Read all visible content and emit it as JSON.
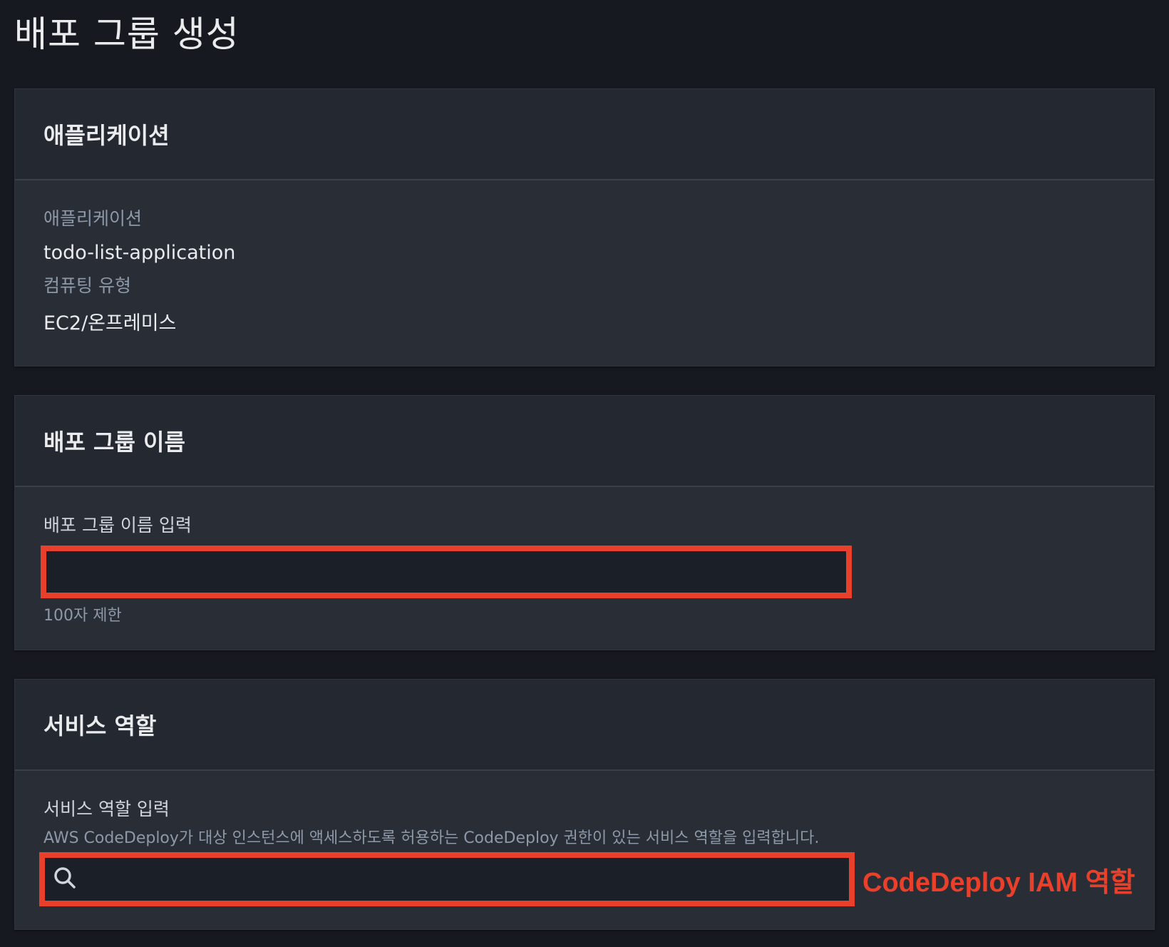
{
  "page": {
    "title": "배포 그룹 생성"
  },
  "application_panel": {
    "header": "애플리케이션",
    "app_label": "애플리케이션",
    "app_value": "todo-list-application",
    "compute_label": "컴퓨팅 유형",
    "compute_value": "EC2/온프레미스"
  },
  "deployment_group_panel": {
    "header": "배포 그룹 이름",
    "input_label": "배포 그룹 이름 입력",
    "input_value": "",
    "hint": "100자 제한"
  },
  "service_role_panel": {
    "header": "서비스 역할",
    "input_label": "서비스 역할 입력",
    "description": "AWS CodeDeploy가 대상 인스턴스에 액세스하도록 허용하는 CodeDeploy 권한이 있는 서비스 역할을 입력합니다.",
    "input_value": "",
    "search_icon": "search-icon"
  },
  "annotation": {
    "text": "CodeDeploy IAM 역할",
    "color": "#e8402a"
  },
  "colors": {
    "background": "#16191f",
    "panel": "#292d36",
    "highlight": "#e8402a"
  }
}
